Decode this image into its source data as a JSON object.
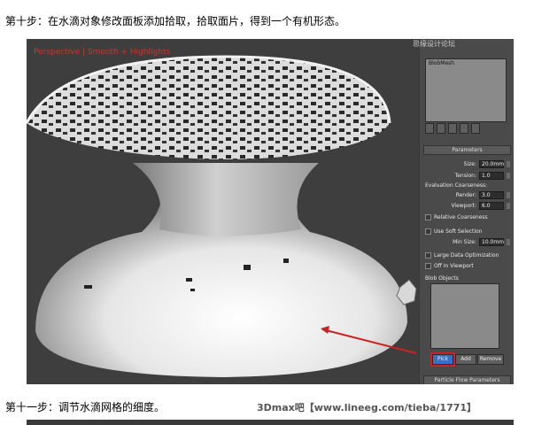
{
  "captions": {
    "step10": "第十步：在水滴对象修改面板添加拾取，拾取面片，得到一个有机形态。",
    "step11": "第十一步：调节水滴网格的细度。"
  },
  "viewport": {
    "label": "Perspective | Smooth + Highlights"
  },
  "panel": {
    "object_name": "BlobMesh",
    "parameters_header": "Parameters",
    "size_label": "Size:",
    "size_value": "20.0mm",
    "tension_label": "Tension:",
    "tension_value": "1.0",
    "eval_label": "Evaluation Coarseness:",
    "render_label": "Render:",
    "render_value": "3.0",
    "viewport_label": "Viewport:",
    "viewport_value": "6.0",
    "relative_coarseness": "Relative Coarseness",
    "use_soft_selection": "Use Soft Selection",
    "min_size_label": "Min Size:",
    "min_size_value": "10.0mm",
    "large_data_opt": "Large Data Optimization",
    "off_in_viewport": "Off In Viewport",
    "blob_objects": "Blob Objects",
    "pick_button": "Pick",
    "add_button": "Add",
    "remove_button": "Remove",
    "particle_flow": "Particle Flow Parameters"
  },
  "watermark": {
    "site": "3Dmax吧【www.lineeg.com/tieba/1771】",
    "top": "思缘设计论坛"
  },
  "colors": {
    "highlight_red": "#cc2222",
    "pick_blue": "#3a6fc9"
  }
}
